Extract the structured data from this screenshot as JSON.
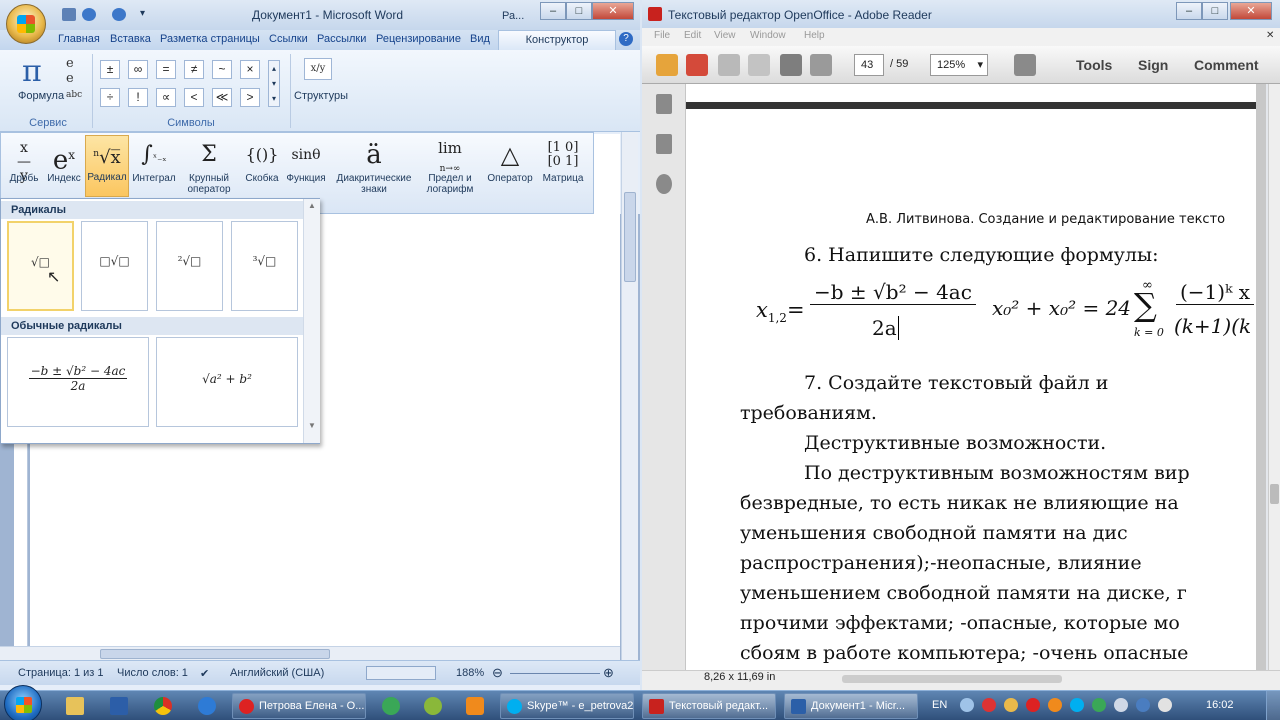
{
  "word": {
    "title": "Документ1 - Microsoft Word",
    "title_suffix": "Ра...",
    "tabs": [
      "Главная",
      "Вставка",
      "Разметка страницы",
      "Ссылки",
      "Рассылки",
      "Рецензирование",
      "Вид"
    ],
    "contextual_tab": "Конструктор",
    "groups": {
      "service_label": "Сервис",
      "formula_label": "Формула",
      "symbols_label": "Символы",
      "structures_label": "Структуры",
      "symbols": [
        "±",
        "∞",
        "=",
        "≠",
        "~",
        "×",
        "÷",
        "!",
        "∝",
        "<",
        "≪",
        ">"
      ]
    },
    "eq_buttons": [
      {
        "glyph": "x/y",
        "label": "Дробь",
        "label2": ""
      },
      {
        "glyph": "eˣ",
        "label": "Индекс",
        "label2": ""
      },
      {
        "glyph": "ⁿ√x",
        "label": "Радикал",
        "label2": ""
      },
      {
        "glyph": "∫",
        "label": "Интеграл",
        "label2": ""
      },
      {
        "glyph": "Σ",
        "label": "Крупный",
        "label2": "оператор"
      },
      {
        "glyph": "{()}",
        "label": "Скобка",
        "label2": ""
      },
      {
        "glyph": "sinθ",
        "label": "Функция",
        "label2": ""
      },
      {
        "glyph": "ä",
        "label": "Диакритические",
        "label2": "знаки"
      },
      {
        "glyph": "lim",
        "label": "Предел и",
        "label2": "логарифм"
      },
      {
        "glyph": "△",
        "label": "Оператор",
        "label2": ""
      },
      {
        "glyph": "[10;01]",
        "label": "Матрица",
        "label2": ""
      }
    ],
    "gallery": {
      "section1": "Радикалы",
      "radicals": [
        "√□",
        "□√□",
        "²√□",
        "³√□"
      ],
      "section2": "Обычные радикалы",
      "common1_num": "−b ± √b² − 4ac",
      "common1_den": "2a",
      "common2": "√a² + b²"
    },
    "status": {
      "page": "Страница: 1 из 1",
      "words": "Число слов: 1",
      "language": "Английский (США)",
      "zoom": "188%"
    }
  },
  "reader": {
    "title": "Текстовый редактор OpenOffice - Adobe Reader",
    "menu": [
      "File",
      "Edit",
      "View",
      "Window",
      "Help"
    ],
    "page_current": "43",
    "page_total": "/ 59",
    "zoom": "125%",
    "tools_label": "Tools",
    "sign_label": "Sign",
    "comment_label": "Comment",
    "page_size": "8,26 x 11,69 in",
    "header_text": "А.В. Литвинова. Создание и редактирование тексто",
    "item6": "6. Напишите следующие формулы:",
    "formula1_lhs": "x",
    "formula1_sub": "1,2",
    "formula1_num": "−b ± √b² − 4ac",
    "formula1_den": "2a",
    "formula2": "x₀² + x₀² = 24",
    "formula3_sum_top": "∞",
    "formula3_sum_bot": "k = 0",
    "formula3_num": "(−1)ᵏ x",
    "formula3_den": "(k+1)(k",
    "item7_line1": "7.   Создайте   текстовый   файл   и",
    "item7_line2": "требованиям.",
    "para1": "Деструктивные возможности.",
    "para2_lines": [
      "По деструктивным возможностям вир",
      "безвредные, то есть никак не влияющие на",
      "уменьшения   свободной   памяти   на   дис",
      "распространения);-неопасные,     влияние",
      "уменьшением свободной памяти на диске, г",
      "прочими эффектами; -опасные, которые мо",
      "сбоям в работе компьютера; -очень опасные"
    ]
  },
  "taskbar": {
    "tasks": [
      "Петрова Елена - О...",
      "Skype™ - e_petrova2",
      "Текстовый редакт...",
      "Документ1 - Micr..."
    ],
    "lang": "EN",
    "clock": "16:02"
  }
}
